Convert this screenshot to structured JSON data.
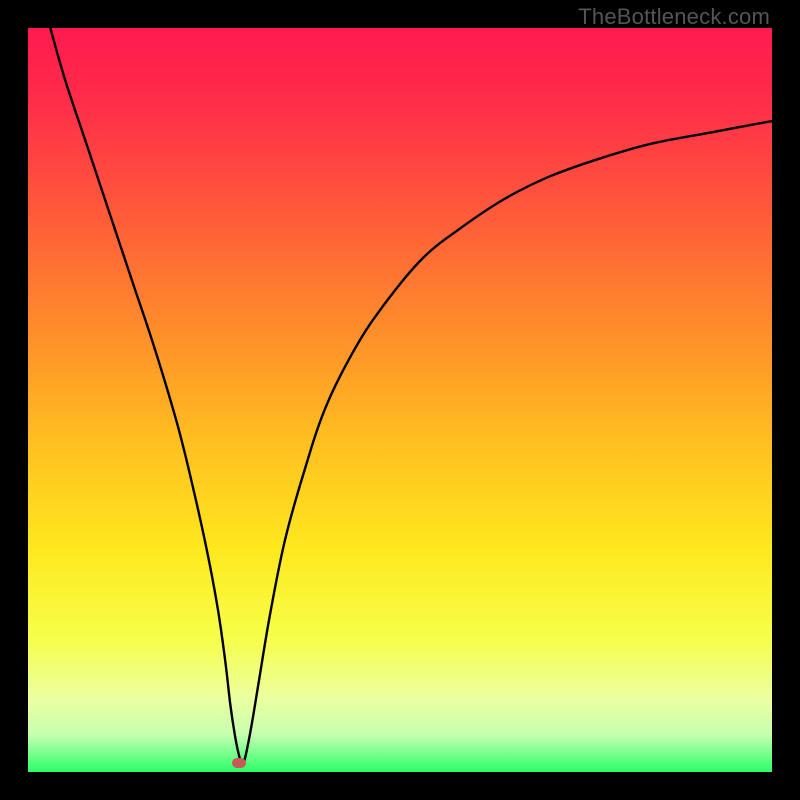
{
  "watermark": "TheBottleneck.com",
  "chart_data": {
    "type": "line",
    "title": "",
    "xlabel": "",
    "ylabel": "",
    "xlim": [
      0,
      100
    ],
    "ylim": [
      0,
      100
    ],
    "grid": false,
    "legend": false,
    "gradient_stops": [
      {
        "pos": 0.0,
        "color": "#ff1a4f"
      },
      {
        "pos": 0.1,
        "color": "#ff2d49"
      },
      {
        "pos": 0.25,
        "color": "#ff5a3a"
      },
      {
        "pos": 0.4,
        "color": "#ff8b2b"
      },
      {
        "pos": 0.55,
        "color": "#ffbd20"
      },
      {
        "pos": 0.7,
        "color": "#ffe81e"
      },
      {
        "pos": 0.82,
        "color": "#f6ff4a"
      },
      {
        "pos": 0.9,
        "color": "#ecffa0"
      },
      {
        "pos": 0.95,
        "color": "#c6ffb0"
      },
      {
        "pos": 1.0,
        "color": "#2aff6a"
      }
    ],
    "series": [
      {
        "name": "bottleneck-curve",
        "x": [
          3,
          5,
          8,
          11,
          14,
          17,
          20,
          22,
          24,
          25.5,
          26.5,
          27.2,
          27.8,
          28.3,
          28.8,
          29.2,
          30,
          31,
          32.5,
          34.5,
          37,
          40,
          44,
          48,
          53,
          58,
          64,
          70,
          77,
          84,
          92,
          100
        ],
        "values": [
          100,
          93,
          84,
          75,
          66,
          57,
          47,
          39,
          30,
          22,
          15,
          9,
          5,
          2.5,
          1.0,
          2.0,
          6,
          12,
          21,
          31,
          40,
          49,
          57,
          63,
          69,
          73,
          77,
          80,
          82.5,
          84.5,
          86,
          87.5
        ]
      }
    ],
    "marker": {
      "x": 28.3,
      "y": 1.2,
      "color": "#c85a56"
    }
  }
}
